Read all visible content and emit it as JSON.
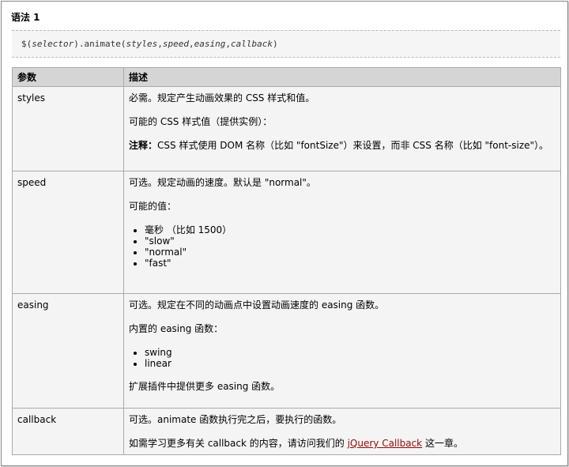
{
  "heading": "语法 1",
  "code": {
    "prefix": "$(",
    "selector": "selector",
    "middle": ").animate(",
    "args": [
      "styles",
      "speed",
      "easing",
      "callback"
    ],
    "sep": ",",
    "suffix": ")"
  },
  "table": {
    "headers": [
      "参数",
      "描述"
    ],
    "rows": [
      {
        "name": "styles",
        "p1": "必需。规定产生动画效果的 CSS 样式和值。",
        "p2": "可能的 CSS 样式值（提供实例）：",
        "note_label": "注释：",
        "note_text": "CSS 样式使用 DOM 名称（比如 \"fontSize\"）来设置，而非 CSS 名称（比如 \"font-size\"）。"
      },
      {
        "name": "speed",
        "p1": "可选。规定动画的速度。默认是 \"normal\"。",
        "p2": "可能的值：",
        "items": [
          "毫秒 （比如 1500）",
          "\"slow\"",
          "\"normal\"",
          "\"fast\""
        ]
      },
      {
        "name": "easing",
        "p1": "可选。规定在不同的动画点中设置动画速度的 easing 函数。",
        "p2": "内置的 easing 函数：",
        "items": [
          "swing",
          "linear"
        ],
        "p3": "扩展插件中提供更多 easing 函数。"
      },
      {
        "name": "callback",
        "p1": "可选。animate 函数执行完之后，要执行的函数。",
        "p2_before": "如需学习更多有关 callback 的内容，请访问我们的 ",
        "p2_link": "jQuery Callback",
        "p2_after": " 这一章。"
      }
    ]
  }
}
